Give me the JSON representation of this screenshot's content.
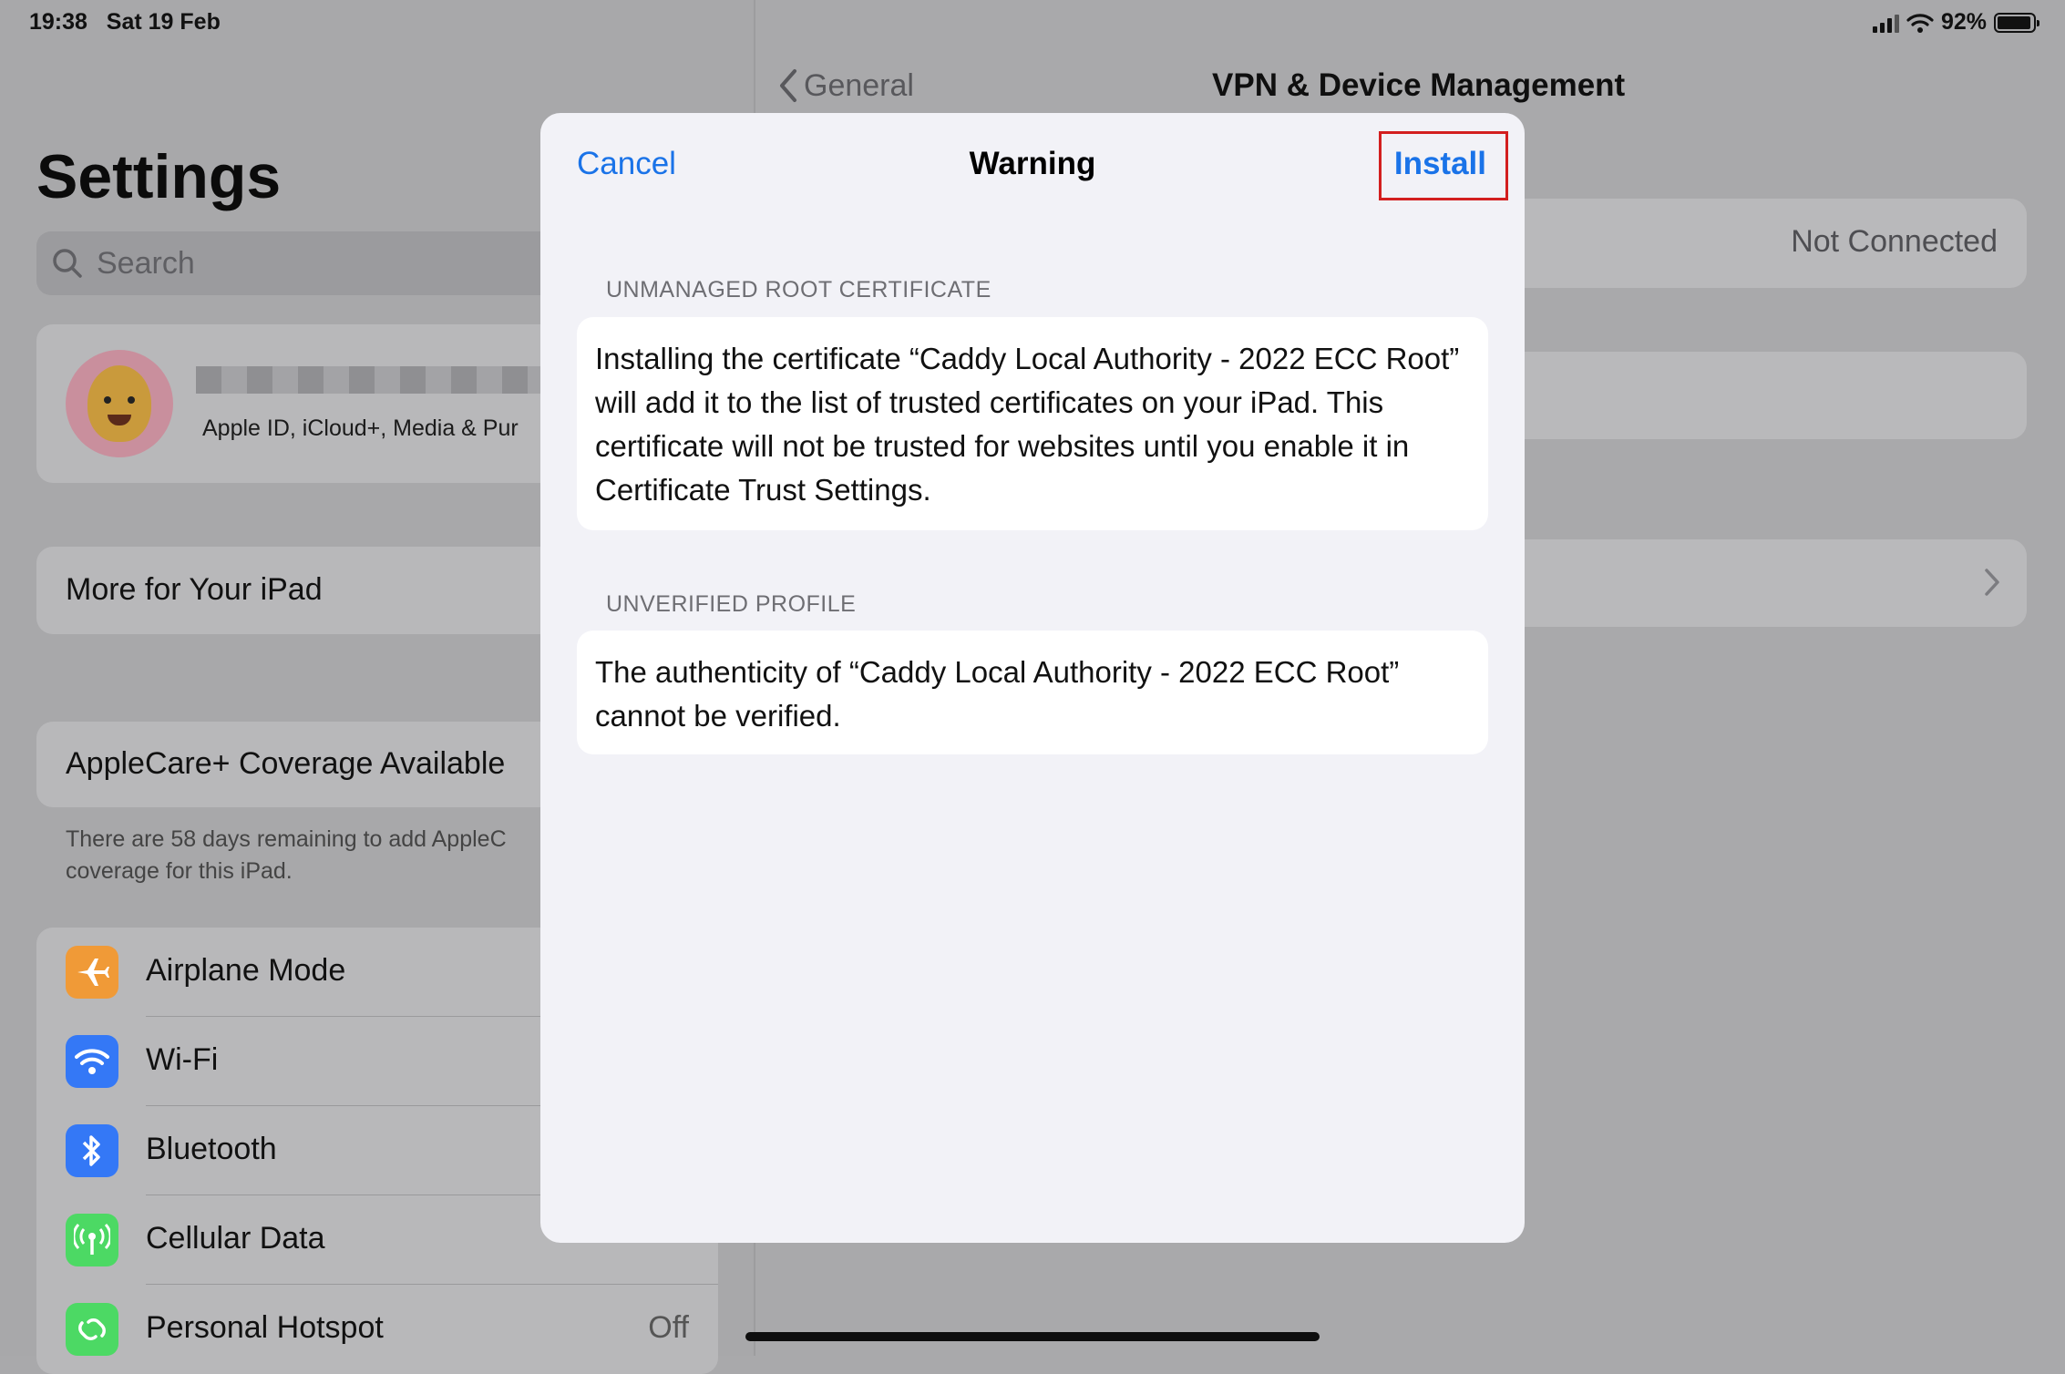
{
  "status_bar": {
    "time": "19:38",
    "date": "Sat 19 Feb",
    "battery": "92%"
  },
  "sidebar": {
    "title": "Settings",
    "search_placeholder": "Search",
    "profile_subtitle": "Apple ID, iCloud+, Media & Pur",
    "more_label": "More for Your iPad",
    "applecare_label": "AppleCare+ Coverage Available",
    "applecare_note": "There are 58 days remaining to add AppleC coverage for this iPad.",
    "items": [
      {
        "label": "Airplane Mode",
        "icon": "airplane-icon",
        "color": "#f09a37",
        "value": ""
      },
      {
        "label": "Wi-Fi",
        "icon": "wifi-icon",
        "color": "#3478f6",
        "value": ""
      },
      {
        "label": "Bluetooth",
        "icon": "bluetooth-icon",
        "color": "#3478f6",
        "value": ""
      },
      {
        "label": "Cellular Data",
        "icon": "antenna-icon",
        "color": "#4cd964",
        "value": ""
      },
      {
        "label": "Personal Hotspot",
        "icon": "hotspot-icon",
        "color": "#4cd964",
        "value": "Off"
      }
    ]
  },
  "detail": {
    "back_label": "General",
    "title": "VPN & Device Management",
    "vpn_status": "Not Connected"
  },
  "modal": {
    "cancel_label": "Cancel",
    "title": "Warning",
    "install_label": "Install",
    "accent_color": "#1a73e8",
    "highlight_color": "#d31f1f",
    "sections": [
      {
        "header": "UNMANAGED ROOT CERTIFICATE",
        "body": "Installing the certificate “Caddy Local Authority - 2022 ECC Root” will add it to the list of trusted certificates on your iPad. This certificate will not be trusted for websites until you enable it in Certificate Trust Settings."
      },
      {
        "header": "UNVERIFIED PROFILE",
        "body": "The authenticity of “Caddy Local Authority - 2022 ECC Root” cannot be verified."
      }
    ]
  }
}
